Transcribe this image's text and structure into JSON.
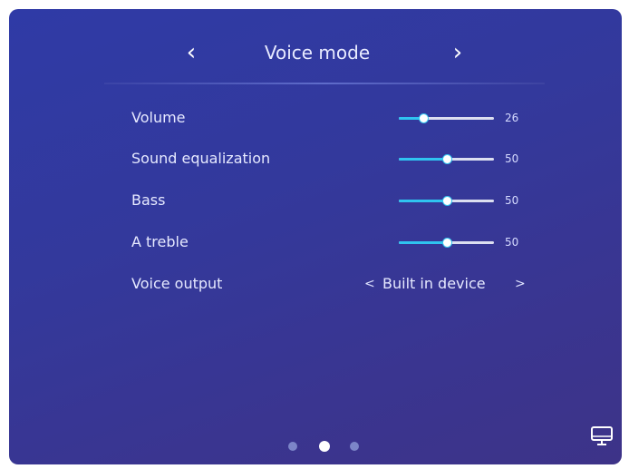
{
  "header": {
    "title": "Voice mode",
    "prev_arrow": "‹",
    "next_arrow": "›"
  },
  "settings": [
    {
      "label": "Volume",
      "value": "26",
      "level": 0.26
    },
    {
      "label": "Sound equalization",
      "value": "50",
      "level": 0.5
    },
    {
      "label": "Bass",
      "value": "50",
      "level": 0.5
    },
    {
      "label": "A treble",
      "value": "50",
      "level": 0.5
    }
  ],
  "voice_output": {
    "label": "Voice output",
    "value": "Built in device",
    "prev_arrow": "<",
    "next_arrow": ">"
  },
  "pagination": {
    "count": 3,
    "active_index": 1
  },
  "icons": {
    "monitor": "monitor-icon"
  },
  "colors": {
    "accent": "#2fc4f0",
    "panel_top": "#2f3aa6",
    "panel_bottom": "#3d3388",
    "text": "#e6e9ff"
  }
}
